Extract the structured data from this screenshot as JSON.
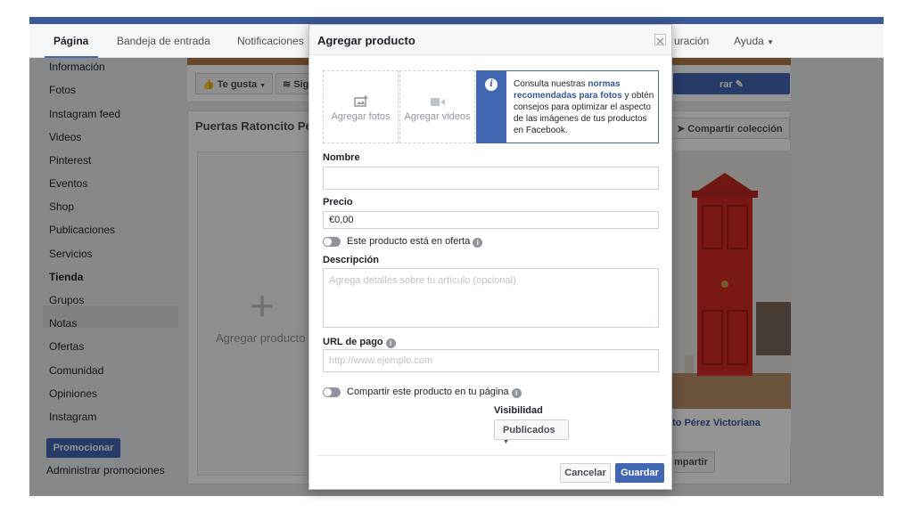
{
  "nav": {
    "tabs": [
      {
        "label": "Página"
      },
      {
        "label": "Bandeja de entrada"
      },
      {
        "label": "Notificaciones"
      },
      {
        "label": "uración"
      },
      {
        "label": "Ayuda"
      }
    ]
  },
  "sidebar": {
    "items": [
      {
        "label": "Información"
      },
      {
        "label": "Fotos"
      },
      {
        "label": "Instagram feed"
      },
      {
        "label": "Videos"
      },
      {
        "label": "Pinterest"
      },
      {
        "label": "Eventos"
      },
      {
        "label": "Shop"
      },
      {
        "label": "Publicaciones"
      },
      {
        "label": "Servicios"
      },
      {
        "label": "Tienda"
      },
      {
        "label": "Grupos"
      },
      {
        "label": "Notas"
      },
      {
        "label": "Ofertas"
      },
      {
        "label": "Comunidad"
      },
      {
        "label": "Opiniones"
      },
      {
        "label": "Instagram"
      }
    ],
    "promote_label": "Promocionar",
    "admin_promos_label": "Administrar promociones"
  },
  "page": {
    "like_label": "Te gusta",
    "follow_label": "Sig",
    "cta_label": "rar",
    "collection_title": "Puertas Ratoncito Pér",
    "share_collection_label": "Compartir colección",
    "add_product_label": "Agregar producto",
    "product_name": "to Pérez Victoriana",
    "share_label": "mpartir"
  },
  "modal": {
    "title": "Agregar producto",
    "add_photos": "Agregar fotos",
    "add_videos": "Agregar videos",
    "info": {
      "pre": "Consulta nuestras ",
      "link": "normas recomendadas para fotos",
      "post": " y obtén consejos para optimizar el aspecto de las imágenes de tus productos en Facebook."
    },
    "name_label": "Nombre",
    "name_value": "",
    "price_label": "Precio",
    "price_value": "€0,00",
    "sale_toggle_label": "Este producto está en oferta",
    "description_label": "Descripción",
    "description_placeholder": "Agrega detalles sobre tu artículo (opcional)",
    "url_label": "URL de pago",
    "url_placeholder": "http://www.ejemplo.com",
    "share_toggle_label": "Compartir este producto en tu página",
    "visibility_label": "Visibilidad",
    "visibility_value": "Publicados",
    "cancel_label": "Cancelar",
    "save_label": "Guardar"
  },
  "colors": {
    "accent": "#4267b2",
    "header_blue": "#3b5998",
    "door_red": "#d22a22"
  }
}
